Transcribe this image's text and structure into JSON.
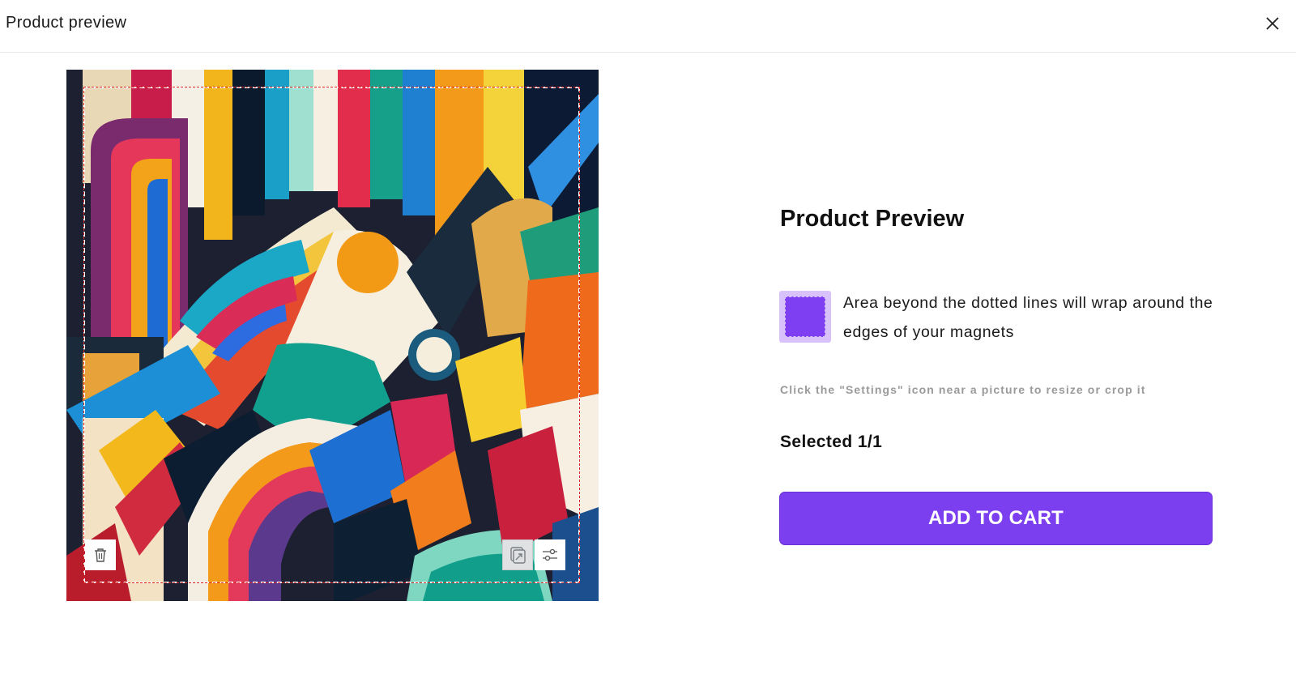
{
  "modal": {
    "title": "Product preview",
    "close_icon": "close-icon"
  },
  "preview": {
    "image_description_icon": "abstract-art-image",
    "tools": {
      "delete_icon": "trash-icon",
      "replace_icon": "swap-image-icon",
      "settings_icon": "sliders-icon"
    }
  },
  "panel": {
    "title": "Product Preview",
    "wrap_note": "Area beyond the dotted lines will wrap around the edges of your magnets",
    "hint": "Click the \"Settings\" icon near a picture to resize or crop it",
    "selected": "Selected 1/1",
    "add_to_cart": "ADD TO CART"
  },
  "colors": {
    "accent": "#7c3ff0",
    "swatch_border": "#d9c2fb",
    "hint": "#9a9a9a"
  }
}
